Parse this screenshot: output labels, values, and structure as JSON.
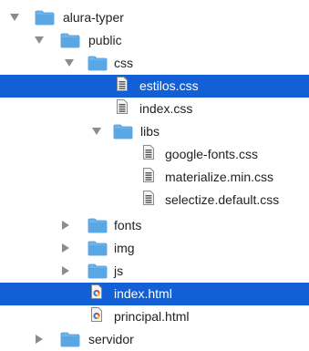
{
  "tree": {
    "items": [
      {
        "label": "alura-typer",
        "icon": "folder-icon",
        "expanded": true,
        "selected": false
      },
      {
        "label": "public",
        "icon": "folder-icon",
        "expanded": true,
        "selected": false
      },
      {
        "label": "css",
        "icon": "folder-icon",
        "expanded": true,
        "selected": false
      },
      {
        "label": "estilos.css",
        "icon": "css-file-icon",
        "selected": true
      },
      {
        "label": "index.css",
        "icon": "css-file-icon",
        "selected": false
      },
      {
        "label": "libs",
        "icon": "folder-icon",
        "expanded": true,
        "selected": false
      },
      {
        "label": "google-fonts.css",
        "icon": "css-file-icon",
        "selected": false
      },
      {
        "label": "materialize.min.css",
        "icon": "css-file-icon",
        "selected": false
      },
      {
        "label": "selectize.default.css",
        "icon": "css-file-icon",
        "selected": false
      },
      {
        "label": "fonts",
        "icon": "folder-icon",
        "expanded": false,
        "selected": false
      },
      {
        "label": "img",
        "icon": "folder-icon",
        "expanded": false,
        "selected": false
      },
      {
        "label": "js",
        "icon": "folder-icon",
        "expanded": false,
        "selected": false
      },
      {
        "label": "index.html",
        "icon": "html-file-icon",
        "selected": true
      },
      {
        "label": "principal.html",
        "icon": "html-file-icon",
        "selected": false
      },
      {
        "label": "servidor",
        "icon": "folder-icon",
        "expanded": false,
        "selected": false
      }
    ]
  },
  "colors": {
    "selection": "#1360d6",
    "folder": "#5aa7e6",
    "disclosure": "#8c8c8c"
  }
}
